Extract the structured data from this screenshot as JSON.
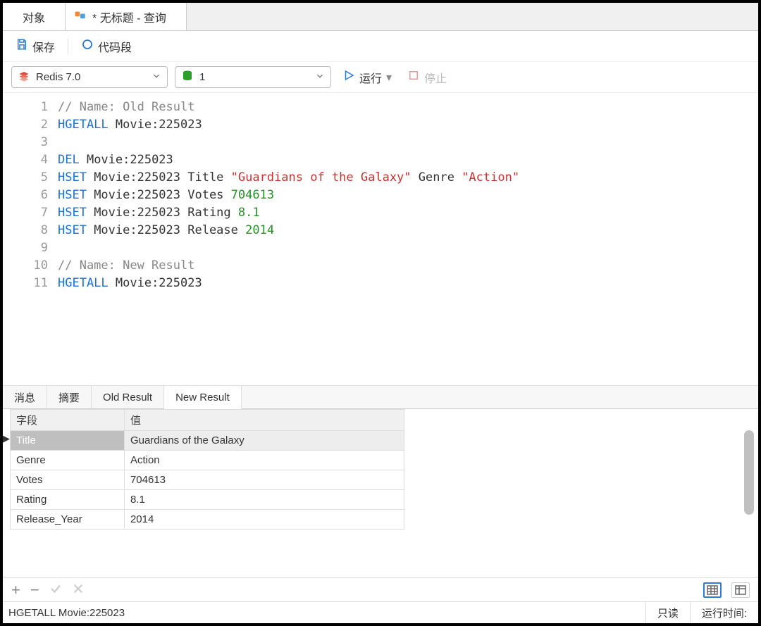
{
  "tabs": {
    "objects": "对象",
    "query": "* 无标题 - 查询"
  },
  "toolbar": {
    "save": "保存",
    "snippet": "代码段"
  },
  "conn": {
    "server": "Redis 7.0",
    "db": "1",
    "run": "运行",
    "stop": "停止"
  },
  "editor": {
    "lines": [
      "// Name: Old Result",
      "HGETALL Movie:225023",
      "",
      "DEL Movie:225023",
      "HSET Movie:225023 Title \"Guardians of the Galaxy\" Genre \"Action\"",
      "HSET Movie:225023 Votes 704613",
      "HSET Movie:225023 Rating 8.1",
      "HSET Movie:225023 Release 2014",
      "",
      "// Name: New Result",
      "HGETALL Movie:225023"
    ],
    "tokens": [
      [
        {
          "t": "// Name: Old Result",
          "c": "comment"
        }
      ],
      [
        {
          "t": "HGETALL",
          "c": "cmd"
        },
        {
          "t": " Movie:225023",
          "c": ""
        }
      ],
      [],
      [
        {
          "t": "DEL",
          "c": "cmd"
        },
        {
          "t": " Movie:225023",
          "c": ""
        }
      ],
      [
        {
          "t": "HSET",
          "c": "cmd"
        },
        {
          "t": " Movie:225023 Title ",
          "c": ""
        },
        {
          "t": "\"Guardians of the Galaxy\"",
          "c": "str"
        },
        {
          "t": " Genre ",
          "c": ""
        },
        {
          "t": "\"Action\"",
          "c": "str"
        }
      ],
      [
        {
          "t": "HSET",
          "c": "cmd"
        },
        {
          "t": " Movie:225023 Votes ",
          "c": ""
        },
        {
          "t": "704613",
          "c": "num"
        }
      ],
      [
        {
          "t": "HSET",
          "c": "cmd"
        },
        {
          "t": " Movie:225023 Rating ",
          "c": ""
        },
        {
          "t": "8.1",
          "c": "num"
        }
      ],
      [
        {
          "t": "HSET",
          "c": "cmd"
        },
        {
          "t": " Movie:225023 Release ",
          "c": ""
        },
        {
          "t": "2014",
          "c": "num"
        }
      ],
      [],
      [
        {
          "t": "// Name: New Result",
          "c": "comment"
        }
      ],
      [
        {
          "t": "HGETALL",
          "c": "cmd"
        },
        {
          "t": " Movie:225023",
          "c": ""
        }
      ]
    ]
  },
  "result_tabs": [
    "消息",
    "摘要",
    "Old Result",
    "New Result"
  ],
  "result_active": 3,
  "table": {
    "headers": [
      "字段",
      "值"
    ],
    "rows": [
      {
        "field": "Title",
        "value": "Guardians of the Galaxy"
      },
      {
        "field": "Genre",
        "value": "Action"
      },
      {
        "field": "Votes",
        "value": "704613"
      },
      {
        "field": "Rating",
        "value": "8.1"
      },
      {
        "field": "Release_Year",
        "value": "2014"
      }
    ],
    "selected": 0
  },
  "status": {
    "command": "HGETALL Movie:225023",
    "readonly": "只读",
    "runtime_label": "运行时间:"
  }
}
